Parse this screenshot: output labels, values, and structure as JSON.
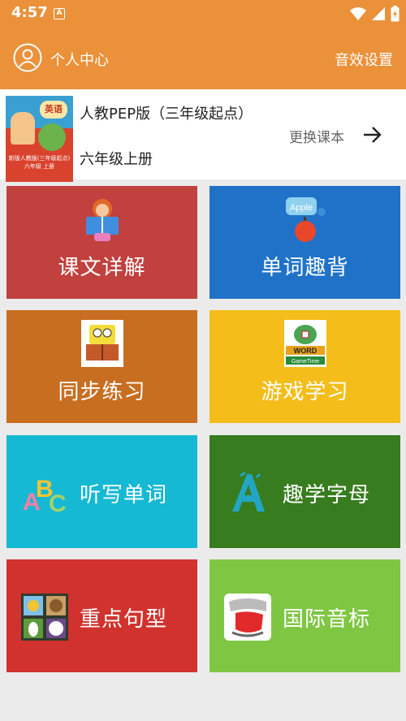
{
  "status_bar": {
    "time": "4:57",
    "notification_badge": "A"
  },
  "app_bar": {
    "profile_label": "个人中心",
    "sound_settings_label": "音效设置",
    "color": "#ea913a"
  },
  "book": {
    "cover_badge": "英语",
    "cover_text": "新版人教版(三年级起点) 六年级 上册",
    "title": "人教PEP版（三年级起点）",
    "grade": "六年级上册",
    "change_label": "更换课本"
  },
  "tiles": [
    {
      "label": "课文详解",
      "icon": "reading-girl-icon",
      "color": "#c1413f"
    },
    {
      "label": "单词趣背",
      "icon": "apple-word-icon",
      "color": "#1f72c8"
    },
    {
      "label": "同步练习",
      "icon": "sponge-book-icon",
      "color": "#c86e21"
    },
    {
      "label": "游戏学习",
      "icon": "word-game-icon",
      "color": "#f5bd1a",
      "icon_text": "WORD",
      "icon_subtext": "GameTime"
    },
    {
      "label": "听写单词",
      "icon": "abc-letters-icon",
      "color": "#16b9d3"
    },
    {
      "label": "趣学字母",
      "icon": "letter-a-icon",
      "color": "#377c1e"
    },
    {
      "label": "重点句型",
      "icon": "animals-grid-icon",
      "color": "#d2322d"
    },
    {
      "label": "国际音标",
      "icon": "mouth-tongue-icon",
      "color": "#7fc643"
    }
  ]
}
